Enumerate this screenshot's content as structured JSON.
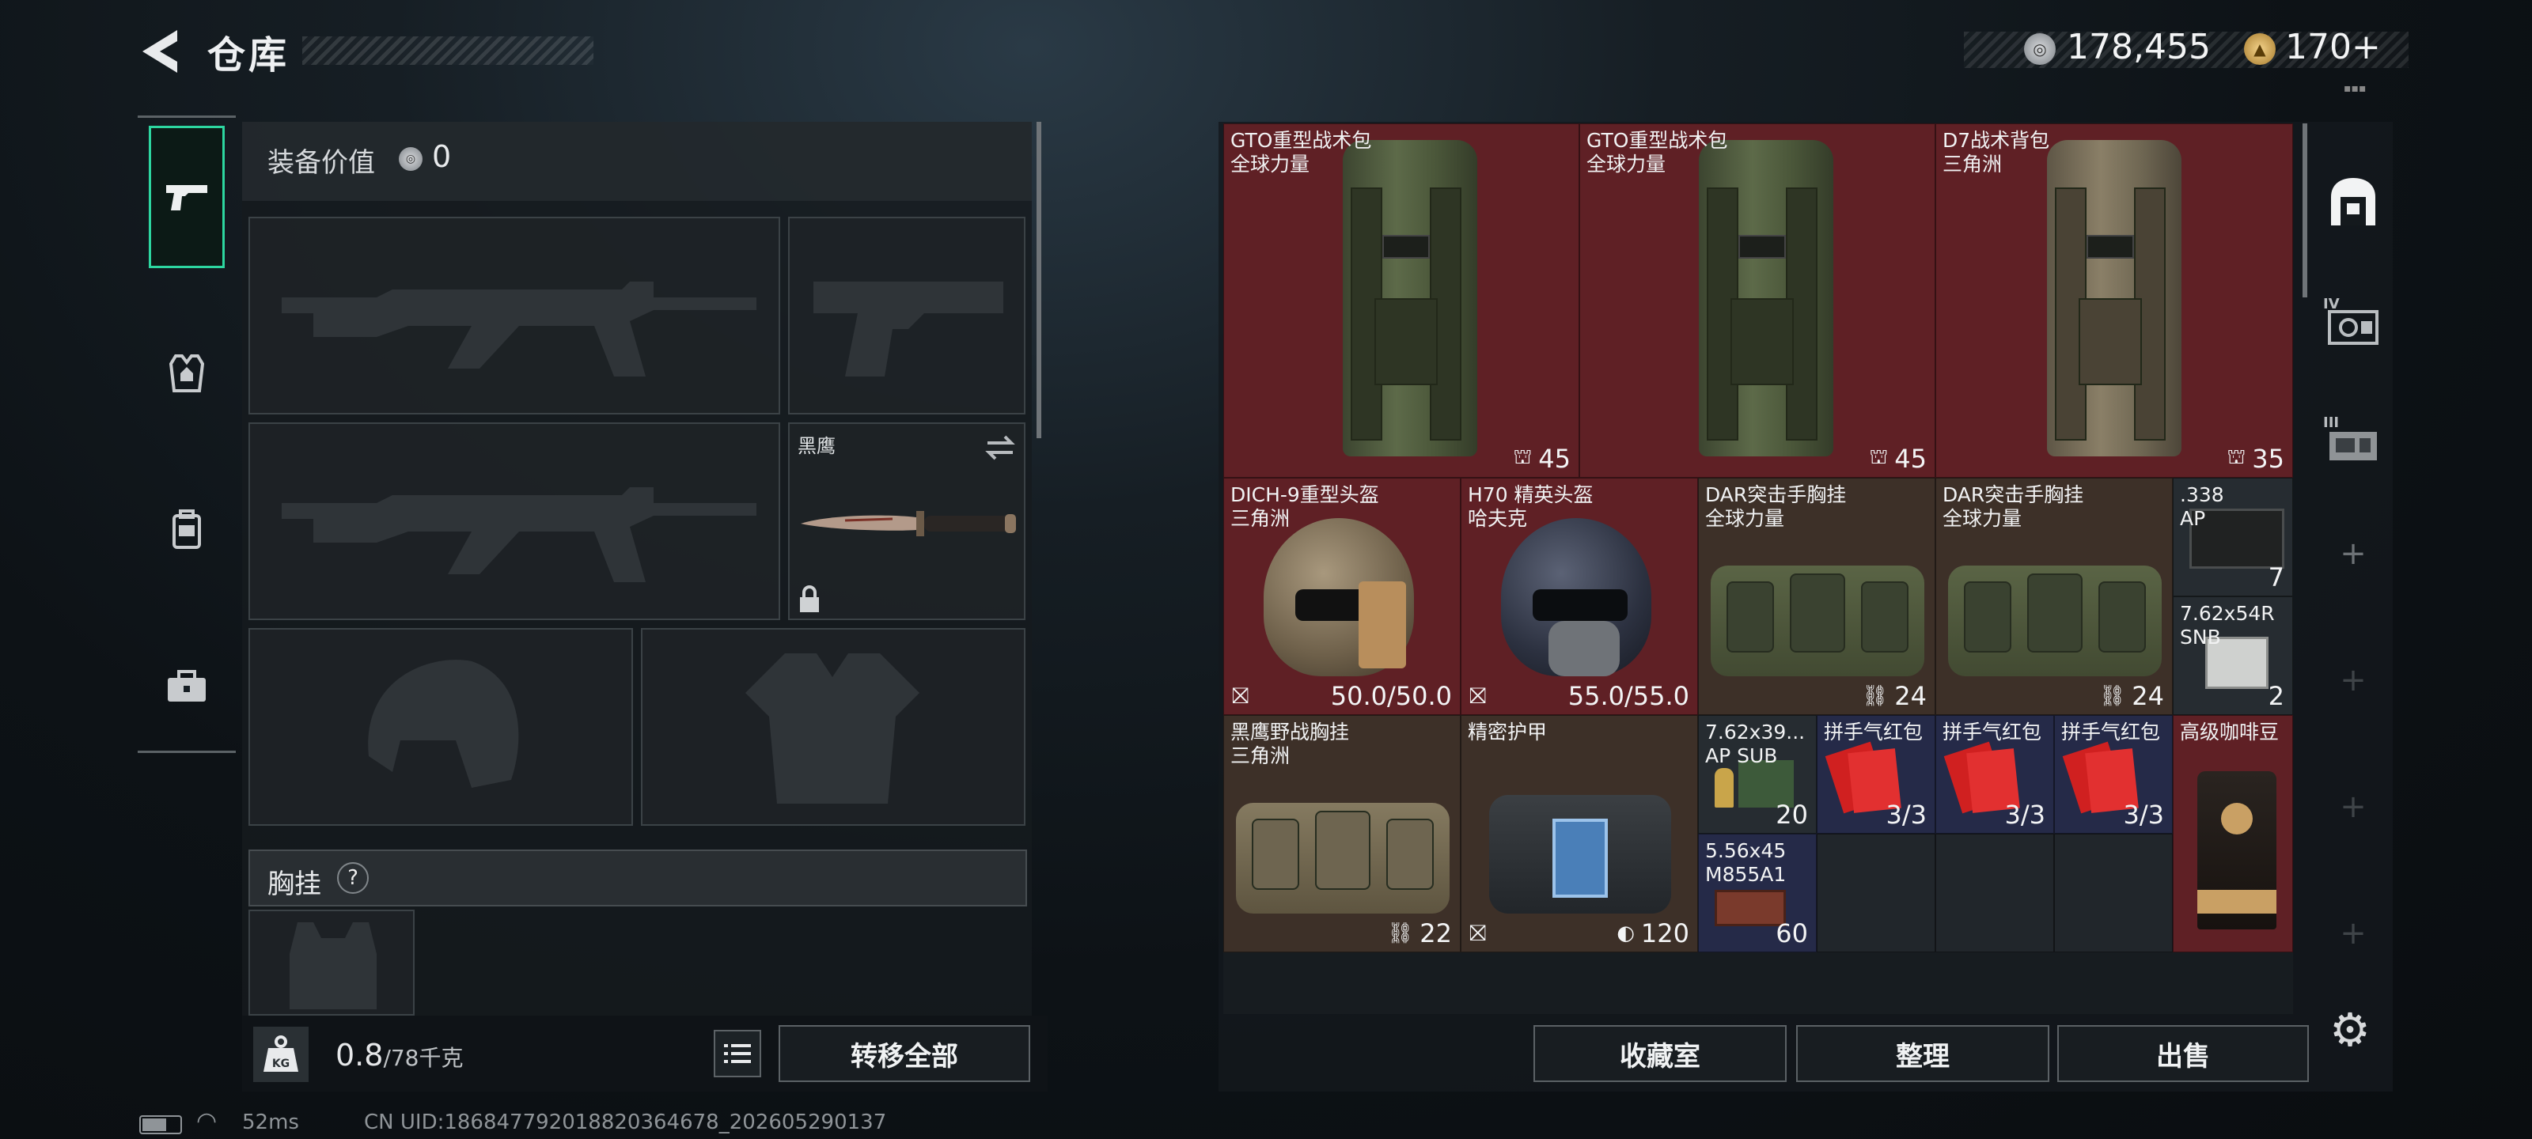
{
  "header": {
    "title": "仓库"
  },
  "currency": {
    "silver": "178,455",
    "gold": "170+",
    "tiny": "▪▪▪"
  },
  "left_tabs": [
    "pistol-icon",
    "armor-vest-icon",
    "backpack-icon",
    "toolbox-icon"
  ],
  "loadout": {
    "value_label": "装备价值",
    "value": "0",
    "knife_label": "黑鹰",
    "section_label": "胸挂",
    "help": "?"
  },
  "bottom_left": {
    "weight": "0.8",
    "capacity": "/78千克",
    "kg_badge": "KG",
    "transfer_label": "转移全部"
  },
  "items": [
    {
      "name": "GTO重型战术包\n全球力量",
      "value": "45"
    },
    {
      "name": "GTO重型战术包\n全球力量",
      "value": "45"
    },
    {
      "name": "D7战术背包\n三角洲",
      "value": "35"
    },
    {
      "name": "DICH-9重型头盔\n三角洲",
      "value": "50.0/50.0"
    },
    {
      "name": "H70 精英头盔\n哈夫克",
      "value": "55.0/55.0"
    },
    {
      "name": "DAR突击手胸挂\n全球力量",
      "value": "24"
    },
    {
      "name": "DAR突击手胸挂\n全球力量",
      "value": "24"
    },
    {
      "name": ".338\nAP",
      "value": "7"
    },
    {
      "name": "7.62x54R\nSNB",
      "value": "2"
    },
    {
      "name": "黑鹰野战胸挂\n三角洲",
      "value": "22"
    },
    {
      "name": "精密护甲",
      "value": "120"
    },
    {
      "name": "7.62x39...\nAP SUB",
      "value": "20"
    },
    {
      "name": "拼手气红包",
      "value": "3/3"
    },
    {
      "name": "拼手气红包",
      "value": "3/3"
    },
    {
      "name": "拼手气红包",
      "value": "3/3"
    },
    {
      "name": "高级咖啡豆",
      "value": ""
    },
    {
      "name": "5.56x45\nM855A1",
      "value": "60"
    }
  ],
  "actions": {
    "collection": "收藏室",
    "sort": "整理",
    "sell": "出售"
  },
  "right_tabs": [
    "safe-box-icon",
    "tier-iv-stash-icon",
    "tier-iii-stash-icon",
    "add-slot-icon"
  ],
  "status": {
    "ping": "52ms",
    "uid": "CN UID:1868477920188203646​78_202605290137"
  },
  "colors": {
    "accent": "#2dd6a0",
    "rare_red": "#5f2025",
    "epic_brown": "#3d3028",
    "blue": "#252a48"
  }
}
